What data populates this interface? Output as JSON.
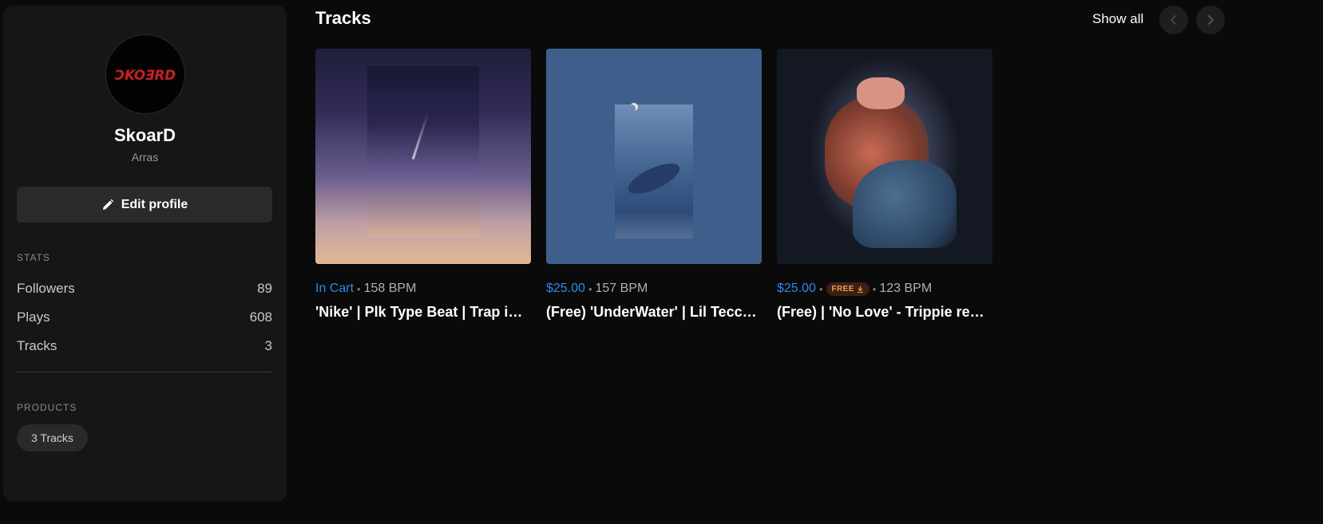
{
  "profile": {
    "name": "SkoarD",
    "location": "Arras",
    "avatar_text": "SKOARD",
    "edit_label": "Edit profile"
  },
  "stats": {
    "heading": "STATS",
    "items": [
      {
        "label": "Followers",
        "value": "89"
      },
      {
        "label": "Plays",
        "value": "608"
      },
      {
        "label": "Tracks",
        "value": "3"
      }
    ]
  },
  "products": {
    "heading": "PRODUCTS",
    "pill": "3 Tracks"
  },
  "main": {
    "title": "Tracks",
    "show_all": "Show all",
    "prev_icon": "chevron-left-icon",
    "next_icon": "chevron-right-icon"
  },
  "tracks": [
    {
      "status": "In Cart",
      "bpm": "158 BPM",
      "title": "'Nike' | Plk Type Beat | Trap instrumental"
    },
    {
      "price": "$25.00",
      "bpm": "157 BPM",
      "title": "(Free) 'UnderWater' | Lil Tecca Type Beat"
    },
    {
      "price": "$25.00",
      "badge": "FREE",
      "bpm": "123 BPM",
      "title": "(Free) | 'No Love' - Trippie redd Type Beat"
    }
  ],
  "colors": {
    "accent": "#2b8ae8",
    "background": "#0a0a0a",
    "panel": "#161616",
    "free_badge_bg": "#3a2113",
    "free_badge_text": "#f39a56"
  }
}
